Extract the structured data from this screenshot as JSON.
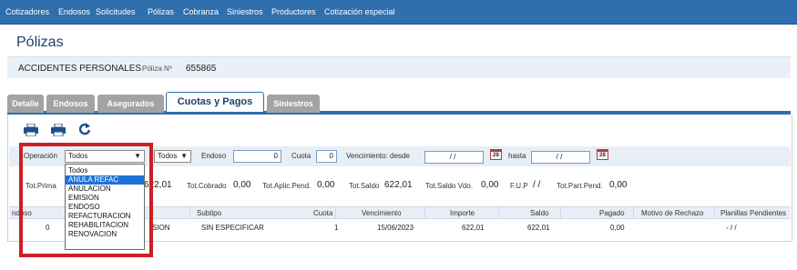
{
  "nav": {
    "items": [
      "Cotizadores",
      "Endosos",
      "Solicitudes",
      "Pólizas",
      "Cobranza",
      "Siniestros",
      "Productores",
      "Cotización especial"
    ]
  },
  "page": {
    "title": "Pólizas"
  },
  "policy": {
    "ramo": "ACCIDENTES PERSONALES",
    "poliza_label": "Póliza Nº",
    "poliza_number": "655865"
  },
  "tabs": [
    "Detalle",
    "Endosos",
    "Asegurados",
    "Cuotas y Pagos",
    "Siniestros"
  ],
  "active_tab": "Cuotas y Pagos",
  "toolbar": {
    "icons": [
      "printer-icon",
      "printer-icon",
      "refresh-icon"
    ]
  },
  "filters": {
    "operacion_label": "Operación",
    "operacion_value": "Todos",
    "second_select_value": "Todos",
    "endoso_label": "Endoso",
    "endoso_value": "0",
    "cuota_label": "Cuota",
    "cuota_value": "0",
    "vencimiento_label": "Vencimiento: desde",
    "desde_value": " / /",
    "hasta_label": "hasta",
    "hasta_value": " / /",
    "calendar_text": "28"
  },
  "dropdown": {
    "options": [
      "Todos",
      "ANULA REFAC",
      "ANULACION",
      "EMISION",
      "ENDOSO",
      "REFACTURACION",
      "REHABILITACION",
      "RENOVACION"
    ],
    "highlighted": "ANULA REFAC"
  },
  "totals": {
    "prima_label": "Tot.Prima",
    "prima_value": "622,01",
    "cobrado_label": "Tot.Cobrado",
    "cobrado_value": "0,00",
    "aplic_label": "Tot.Aplic.Pend.",
    "aplic_value": "0,00",
    "saldo_label": "Tot.Saldo",
    "saldo_value": "622,01",
    "saldo_vdo_label": "Tot.Saldo Vdo.",
    "saldo_vdo_value": "0,00",
    "fup_label": "F.U.P",
    "fup_value": "/ /",
    "part_label": "Tot.Part.Pend.",
    "part_value": "0,00"
  },
  "table": {
    "headers": [
      "ndoso",
      "Subtipo",
      "Cuota",
      "Vencimiento",
      "Importe",
      "Saldo",
      "Pagado",
      "Motivo de Rechazo",
      "Planillas Pendientes"
    ],
    "row": {
      "endoso": "0",
      "operacion_fragment": "SION",
      "subtipo": "SIN ESPECIFICAR",
      "cuota": "1",
      "vencimiento": "15/06/2023",
      "importe": "622,01",
      "saldo": "622,01",
      "pagado": "0,00",
      "motivo": "",
      "planillas": "- / /"
    }
  },
  "colors": {
    "nav_bg": "#2f6fae",
    "highlight": "#1e73d8",
    "annotation": "#cc1f25"
  }
}
